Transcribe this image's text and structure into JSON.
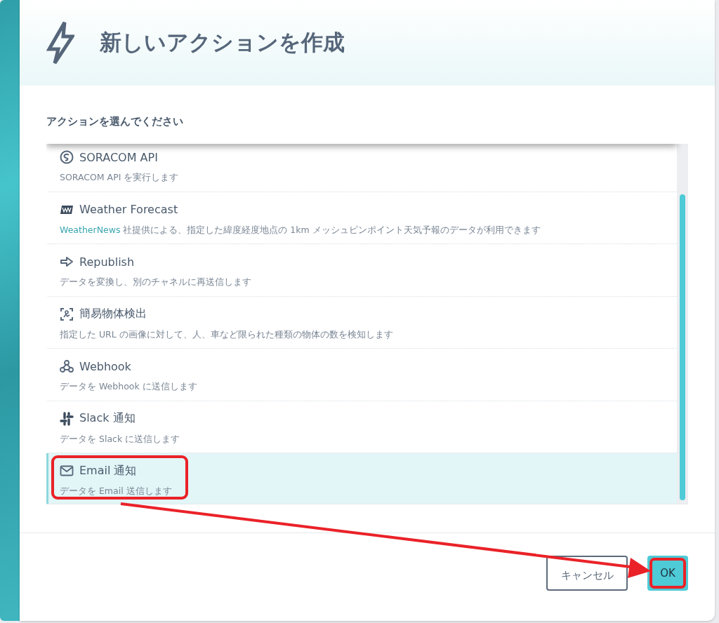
{
  "dialog": {
    "title": "新しいアクションを作成",
    "prompt": "アクションを選んでください"
  },
  "actions": [
    {
      "kind": "api",
      "name": "SORACOM API",
      "description": "SORACOM API を実行します",
      "selected": false
    },
    {
      "kind": "weather",
      "name": "Weather Forecast",
      "link": "WeatherNews",
      "description": "社提供による、指定した緯度経度地点の 1km メッシュピンポイント天気予報のデータが利用できます",
      "selected": false
    },
    {
      "kind": "republish",
      "name": "Republish",
      "description": "データを変換し、別のチャネルに再送信します",
      "selected": false
    },
    {
      "kind": "detection",
      "name": "簡易物体検出",
      "description": "指定した URL の画像に対して、人、車など限られた種類の物体の数を検知します",
      "selected": false
    },
    {
      "kind": "webhook",
      "name": "Webhook",
      "description": "データを Webhook に送信します",
      "selected": false
    },
    {
      "kind": "slack",
      "name": "Slack 通知",
      "description": "データを Slack に送信します",
      "selected": false
    },
    {
      "kind": "email",
      "name": "Email 通知",
      "description": "データを Email 送信します",
      "selected": true
    }
  ],
  "buttons": {
    "cancel": "キャンセル",
    "ok": "OK"
  }
}
